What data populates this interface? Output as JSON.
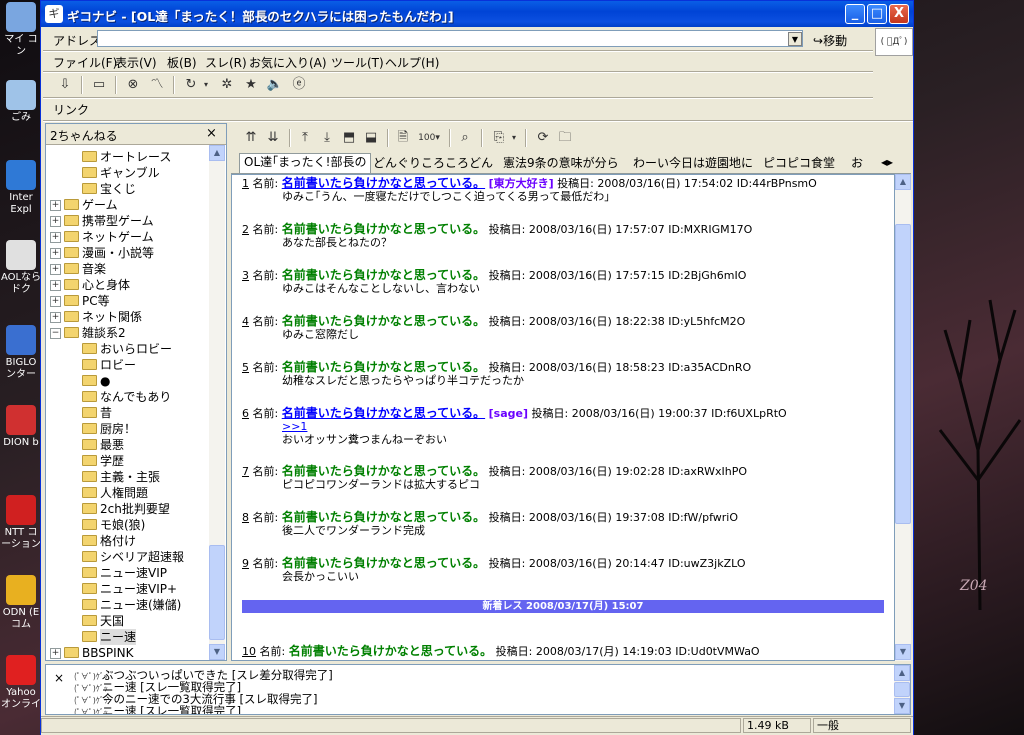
{
  "window": {
    "title": "ギコナビ - [OL達「まったく！部長のセクハラには困ったもんだわ」]",
    "controls": {
      "minimize": "_",
      "maximize": "□",
      "close": "X"
    }
  },
  "address_bar": {
    "label": "アドレス",
    "value": "",
    "go_label": "移動"
  },
  "menu": [
    "ファイル(F)",
    "表示(V)",
    "板(B)",
    "スレ(R)",
    "お気に入り(A)",
    "ツール(T)",
    "ヘルプ(H)"
  ],
  "link_bar": {
    "label": "リンク"
  },
  "left_pane": {
    "title": "2ちゃんねる",
    "close": "×",
    "tree": [
      {
        "label": "オートレース",
        "level": 2
      },
      {
        "label": "ギャンブル",
        "level": 2
      },
      {
        "label": "宝くじ",
        "level": 2
      },
      {
        "label": "ゲーム",
        "level": 1,
        "expander": "+"
      },
      {
        "label": "携帯型ゲーム",
        "level": 1,
        "expander": "+"
      },
      {
        "label": "ネットゲーム",
        "level": 1,
        "expander": "+"
      },
      {
        "label": "漫画・小説等",
        "level": 1,
        "expander": "+"
      },
      {
        "label": "音楽",
        "level": 1,
        "expander": "+"
      },
      {
        "label": "心と身体",
        "level": 1,
        "expander": "+"
      },
      {
        "label": "PC等",
        "level": 1,
        "expander": "+"
      },
      {
        "label": "ネット関係",
        "level": 1,
        "expander": "+"
      },
      {
        "label": "雑談系2",
        "level": 1,
        "expander": "−"
      },
      {
        "label": "おいらロビー",
        "level": 2
      },
      {
        "label": "ロビー",
        "level": 2
      },
      {
        "label": "●",
        "level": 2
      },
      {
        "label": "なんでもあり",
        "level": 2
      },
      {
        "label": "昔",
        "level": 2
      },
      {
        "label": "厨房！",
        "level": 2
      },
      {
        "label": "最悪",
        "level": 2
      },
      {
        "label": "学歴",
        "level": 2
      },
      {
        "label": "主義・主張",
        "level": 2
      },
      {
        "label": "人権問題",
        "level": 2
      },
      {
        "label": "2ch批判要望",
        "level": 2
      },
      {
        "label": "モ娘(狼)",
        "level": 2
      },
      {
        "label": "格付け",
        "level": 2
      },
      {
        "label": "シベリア超速報",
        "level": 2
      },
      {
        "label": "ニュー速VIP",
        "level": 2
      },
      {
        "label": "ニュー速VIP+",
        "level": 2
      },
      {
        "label": "ニュー速(嫌儲)",
        "level": 2
      },
      {
        "label": "天国",
        "level": 2
      },
      {
        "label": "ニー速",
        "level": 2,
        "selected": true
      },
      {
        "label": "BBSPINK",
        "level": 1,
        "expander": "+"
      }
    ]
  },
  "tabs": [
    {
      "label": "OL達｢まったく!部長の",
      "active": true
    },
    {
      "label": "どんぐりころころどん"
    },
    {
      "label": "憲法9条の意味が分ら"
    },
    {
      "label": "わーい今日は遊園地に"
    },
    {
      "label": "ピコピコ食堂"
    },
    {
      "label": "お"
    }
  ],
  "posts": [
    {
      "num": "1",
      "name_label": "名前:",
      "name": "名前書いたら負けかなと思っている。",
      "linked": true,
      "mail": "[東方大好き]",
      "date_label": "投稿日:",
      "date": "2008/03/16(日) 17:54:02",
      "id": "ID:44rBPnsmO",
      "body": [
        "ゆみこ｢うん、一度寝ただけでしつこく迫ってくる男って最低だわ｣"
      ]
    },
    {
      "num": "2",
      "name_label": "名前:",
      "name": "名前書いたら負けかなと思っている。",
      "date_label": "投稿日:",
      "date": "2008/03/16(日) 17:57:07",
      "id": "ID:MXRIGM17O",
      "body": [
        "あなた部長とねたの？"
      ]
    },
    {
      "num": "3",
      "name_label": "名前:",
      "name": "名前書いたら負けかなと思っている。",
      "date_label": "投稿日:",
      "date": "2008/03/16(日) 17:57:15",
      "id": "ID:2BjGh6mIO",
      "body": [
        "ゆみこはそんなことしないし、言わない"
      ]
    },
    {
      "num": "4",
      "name_label": "名前:",
      "name": "名前書いたら負けかなと思っている。",
      "date_label": "投稿日:",
      "date": "2008/03/16(日) 18:22:38",
      "id": "ID:yL5hfcM2O",
      "body": [
        "ゆみこ窓際だし"
      ]
    },
    {
      "num": "5",
      "name_label": "名前:",
      "name": "名前書いたら負けかなと思っている。",
      "date_label": "投稿日:",
      "date": "2008/03/16(日) 18:58:23",
      "id": "ID:a35ACDnRO",
      "body": [
        "幼稚なスレだと思ったらやっぱり半コテだったか"
      ]
    },
    {
      "num": "6",
      "name_label": "名前:",
      "name": "名前書いたら負けかなと思っている。",
      "linked": true,
      "mail": "[sage]",
      "date_label": "投稿日:",
      "date": "2008/03/16(日) 19:00:37",
      "id": "ID:f6UXLpRtO",
      "anchor": ">>1",
      "body": [
        "おいオッサン糞つまんねーぞおい"
      ]
    },
    {
      "num": "7",
      "name_label": "名前:",
      "name": "名前書いたら負けかなと思っている。",
      "date_label": "投稿日:",
      "date": "2008/03/16(日) 19:02:28",
      "id": "ID:axRWxIhPO",
      "body": [
        "ピコピコワンダーランドは拡大するピコ"
      ]
    },
    {
      "num": "8",
      "name_label": "名前:",
      "name": "名前書いたら負けかなと思っている。",
      "date_label": "投稿日:",
      "date": "2008/03/16(日) 19:37:08",
      "id": "ID:fW/pfwriO",
      "body": [
        "後二人でワンダーランド完成"
      ]
    },
    {
      "num": "9",
      "name_label": "名前:",
      "name": "名前書いたら負けかなと思っている。",
      "date_label": "投稿日:",
      "date": "2008/03/16(日) 20:14:47",
      "id": "ID:uwZ3jkZLO",
      "body": [
        "会長かっこいい"
      ]
    },
    {
      "num": "10",
      "name_label": "名前:",
      "name": "名前書いたら負けかなと思っている。",
      "date_label": "投稿日:",
      "date": "2008/03/17(月) 14:19:03",
      "id": "ID:Ud0tVMWaO",
      "body": []
    }
  ],
  "new_res_bar": "新着レス 2008/03/17(月) 15:07",
  "log": [
    {
      "icon": "(ﾟ∀ﾟ)ｹﾞｯ",
      "text": "ぶつぶついっぱいできた [スレ差分取得完了]"
    },
    {
      "icon": "(ﾟ∀ﾟ)ｹﾞｯ",
      "text": "ニー速 [スレ一覧取得完了]"
    },
    {
      "icon": "(ﾟ∀ﾟ)ｹﾞｯ",
      "text": "今のニー速での3大流行事 [スレ取得完了]"
    },
    {
      "icon": "(ﾟ∀ﾟ)ｹﾞｯ",
      "text": "ニー速 [スレ一覧取得完了]"
    }
  ],
  "log_close": "×",
  "status": {
    "size": "1.49 kB",
    "mode": "一般"
  },
  "desktop_icons": [
    {
      "label": "マイ コン",
      "color": "#7aa6e0"
    },
    {
      "label": "ごみ",
      "color": "#9fc3e8"
    },
    {
      "label": "Inter Expl",
      "color": "#2f79d6"
    },
    {
      "label": "AOLなら ドク",
      "color": "#e0e0e0"
    },
    {
      "label": "BIGLO ンター",
      "color": "#3a6fd0"
    },
    {
      "label": "DION b",
      "color": "#d03030"
    },
    {
      "label": "NTT コ ーション",
      "color": "#d02020"
    },
    {
      "label": "ODN (E コム",
      "color": "#e8b020"
    },
    {
      "label": "Yahoo オンライ",
      "color": "#e02020"
    }
  ],
  "desktop_signature": "Z04"
}
